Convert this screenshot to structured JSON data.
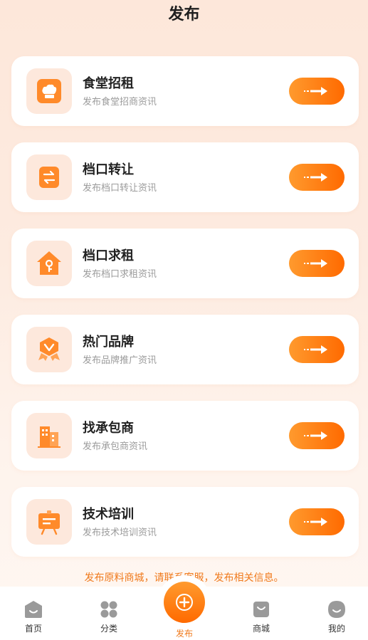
{
  "header": {
    "title": "发布"
  },
  "cards": [
    {
      "title": "食堂招租",
      "desc": "发布食堂招商资讯",
      "icon": "chef-hat-icon"
    },
    {
      "title": "档口转让",
      "desc": "发布档口转让资讯",
      "icon": "transfer-arrows-icon"
    },
    {
      "title": "档口求租",
      "desc": "发布档口求租资讯",
      "icon": "house-key-icon"
    },
    {
      "title": "热门品牌",
      "desc": "发布品牌推广资讯",
      "icon": "badge-ribbon-icon"
    },
    {
      "title": "找承包商",
      "desc": "发布承包商资讯",
      "icon": "building-icon"
    },
    {
      "title": "技术培训",
      "desc": "发布技术培训资讯",
      "icon": "training-board-icon"
    }
  ],
  "notice": "发布原料商城，请联系客服，发布相关信息。",
  "tabbar": {
    "home": "首页",
    "category": "分类",
    "publish": "发布",
    "mall": "商城",
    "mine": "我的"
  },
  "colors": {
    "accent": "#ff7a12",
    "accent_light": "#fde8dc",
    "text_secondary": "#9b9b9b"
  }
}
